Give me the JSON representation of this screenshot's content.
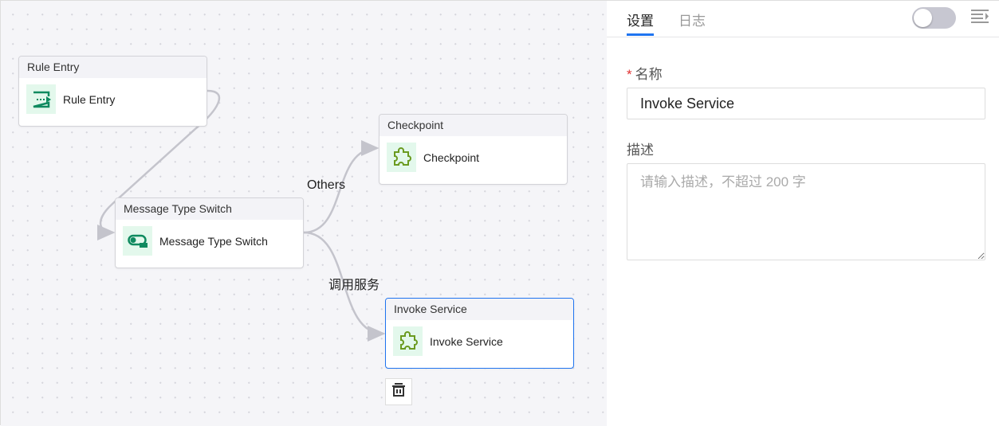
{
  "canvas": {
    "nodes": [
      {
        "header": "Rule Entry",
        "label": "Rule Entry",
        "icon": "rule-entry-icon"
      },
      {
        "header": "Message Type Switch",
        "label": "Message Type Switch",
        "icon": "switch-icon"
      },
      {
        "header": "Checkpoint",
        "label": "Checkpoint",
        "icon": "puzzle-icon"
      },
      {
        "header": "Invoke Service",
        "label": "Invoke Service",
        "icon": "puzzle-icon",
        "selected": true
      }
    ],
    "edge_labels": {
      "others": "Others",
      "invoke": "调用服务"
    },
    "delete_icon": "trash-icon"
  },
  "panel": {
    "tabs": [
      {
        "label": "设置",
        "active": true
      },
      {
        "label": "日志",
        "active": false
      }
    ],
    "toggle_on": false,
    "name_label": "名称",
    "required_mark": "*",
    "name_value": "Invoke Service",
    "desc_label": "描述",
    "desc_placeholder": "请输入描述，不超过 200 字"
  },
  "colors": {
    "accent": "#1f74f0",
    "icon_green": "#0f8a5f",
    "puzzle": "#6a9a1f"
  }
}
